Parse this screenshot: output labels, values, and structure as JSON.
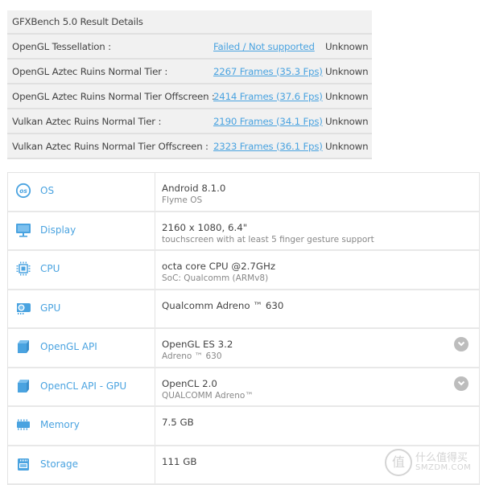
{
  "results": {
    "title": "GFXBench 5.0 Result Details",
    "rows": [
      {
        "label": "OpenGL Tessellation :",
        "result": "Failed / Not supported",
        "status": "Unknown"
      },
      {
        "label": "OpenGL Aztec Ruins Normal Tier :",
        "result": "2267 Frames (35.3 Fps)",
        "status": "Unknown"
      },
      {
        "label": "OpenGL Aztec Ruins Normal Tier Offscreen :",
        "result": "2414 Frames (37.6 Fps)",
        "status": "Unknown"
      },
      {
        "label": "Vulkan Aztec Ruins Normal Tier :",
        "result": "2190 Frames (34.1 Fps)",
        "status": "Unknown"
      },
      {
        "label": "Vulkan Aztec Ruins Normal Tier Offscreen :",
        "result": "2323 Frames (36.1 Fps)",
        "status": "Unknown"
      }
    ]
  },
  "specs": {
    "accent_color": "#4aa3e0",
    "rows": [
      {
        "icon": "os-icon",
        "name": "OS",
        "value": "Android 8.1.0",
        "sub": "Flyme OS",
        "expandable": false
      },
      {
        "icon": "display-icon",
        "name": "Display",
        "value": "2160 x 1080, 6.4\"",
        "sub": "touchscreen with at least 5 finger gesture support",
        "expandable": false
      },
      {
        "icon": "cpu-icon",
        "name": "CPU",
        "value": "octa core CPU @2.7GHz",
        "sub": "SoC: Qualcomm (ARMv8)",
        "expandable": false
      },
      {
        "icon": "gpu-icon",
        "name": "GPU",
        "value": "Qualcomm Adreno ™ 630",
        "sub": "",
        "expandable": false
      },
      {
        "icon": "cube-icon",
        "name": "OpenGL API",
        "value": "OpenGL ES 3.2",
        "sub": "Adreno ™ 630",
        "expandable": true
      },
      {
        "icon": "cube-icon",
        "name": "OpenCL API - GPU",
        "value": "OpenCL 2.0",
        "sub": "QUALCOMM Adreno™",
        "expandable": true
      },
      {
        "icon": "memory-icon",
        "name": "Memory",
        "value": "7.5 GB",
        "sub": "",
        "expandable": false
      },
      {
        "icon": "storage-icon",
        "name": "Storage",
        "value": "111 GB",
        "sub": "",
        "expandable": false
      }
    ]
  },
  "watermark": {
    "seal": "值",
    "chinese": "什么值得买",
    "english": "SMZDM.COM"
  }
}
